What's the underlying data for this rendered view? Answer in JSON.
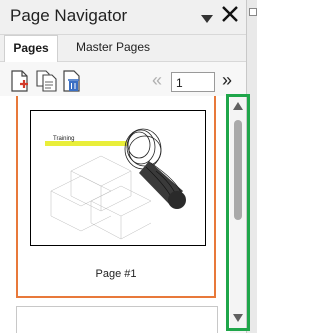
{
  "panel": {
    "title": "Page Navigator",
    "close_symbol": "✕",
    "menu_icon": "triangle-down-icon"
  },
  "tabs": [
    {
      "label": "Pages",
      "active": true
    },
    {
      "label": "Master Pages",
      "active": false
    }
  ],
  "toolbar": {
    "buttons": [
      "add-page-icon",
      "duplicate-page-icon",
      "delete-page-icon"
    ],
    "prev_symbol": "«",
    "page_number": "1",
    "next_symbol": "»"
  },
  "pages": [
    {
      "label": "Page #1",
      "thumbnail_text": "Training",
      "selected": true
    }
  ],
  "colors": {
    "selected_border": "#e8793a",
    "highlight": "#1fa64a",
    "title_bar": "#f0f0f0"
  }
}
